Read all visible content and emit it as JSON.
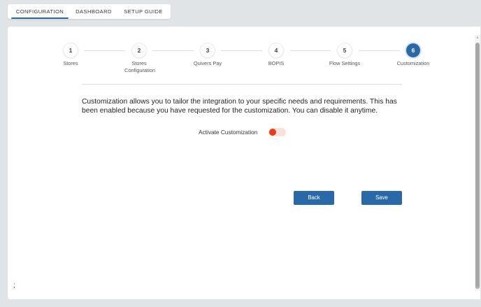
{
  "tabs": [
    {
      "label": "CONFIGURATION"
    },
    {
      "label": "DASHBOARD"
    },
    {
      "label": "SETUP GUIDE"
    }
  ],
  "active_tab": "CONFIGURATION",
  "stepper": {
    "steps": [
      {
        "number": "1",
        "label": "Stores"
      },
      {
        "number": "2",
        "label": "Stores Configuration"
      },
      {
        "number": "3",
        "label": "Quivers Pay"
      },
      {
        "number": "4",
        "label": "BOPIS"
      },
      {
        "number": "5",
        "label": "Flow Settings"
      },
      {
        "number": "6",
        "label": "Customization"
      }
    ],
    "active_step": 6
  },
  "main": {
    "description": "Customization allows you to tailor the integration to your specific needs and requirements. This has been enabled because you have requested for the customization. You can disable it anytime.",
    "activate_label": "Activate Customization",
    "toggle_state": "off",
    "back_label": "Back",
    "save_label": "Save",
    "footer_text": ";"
  },
  "colors": {
    "primary": "#2a69a8",
    "toggle_knob": "#ea3a1b",
    "toggle_track": "#fbe1dc"
  }
}
